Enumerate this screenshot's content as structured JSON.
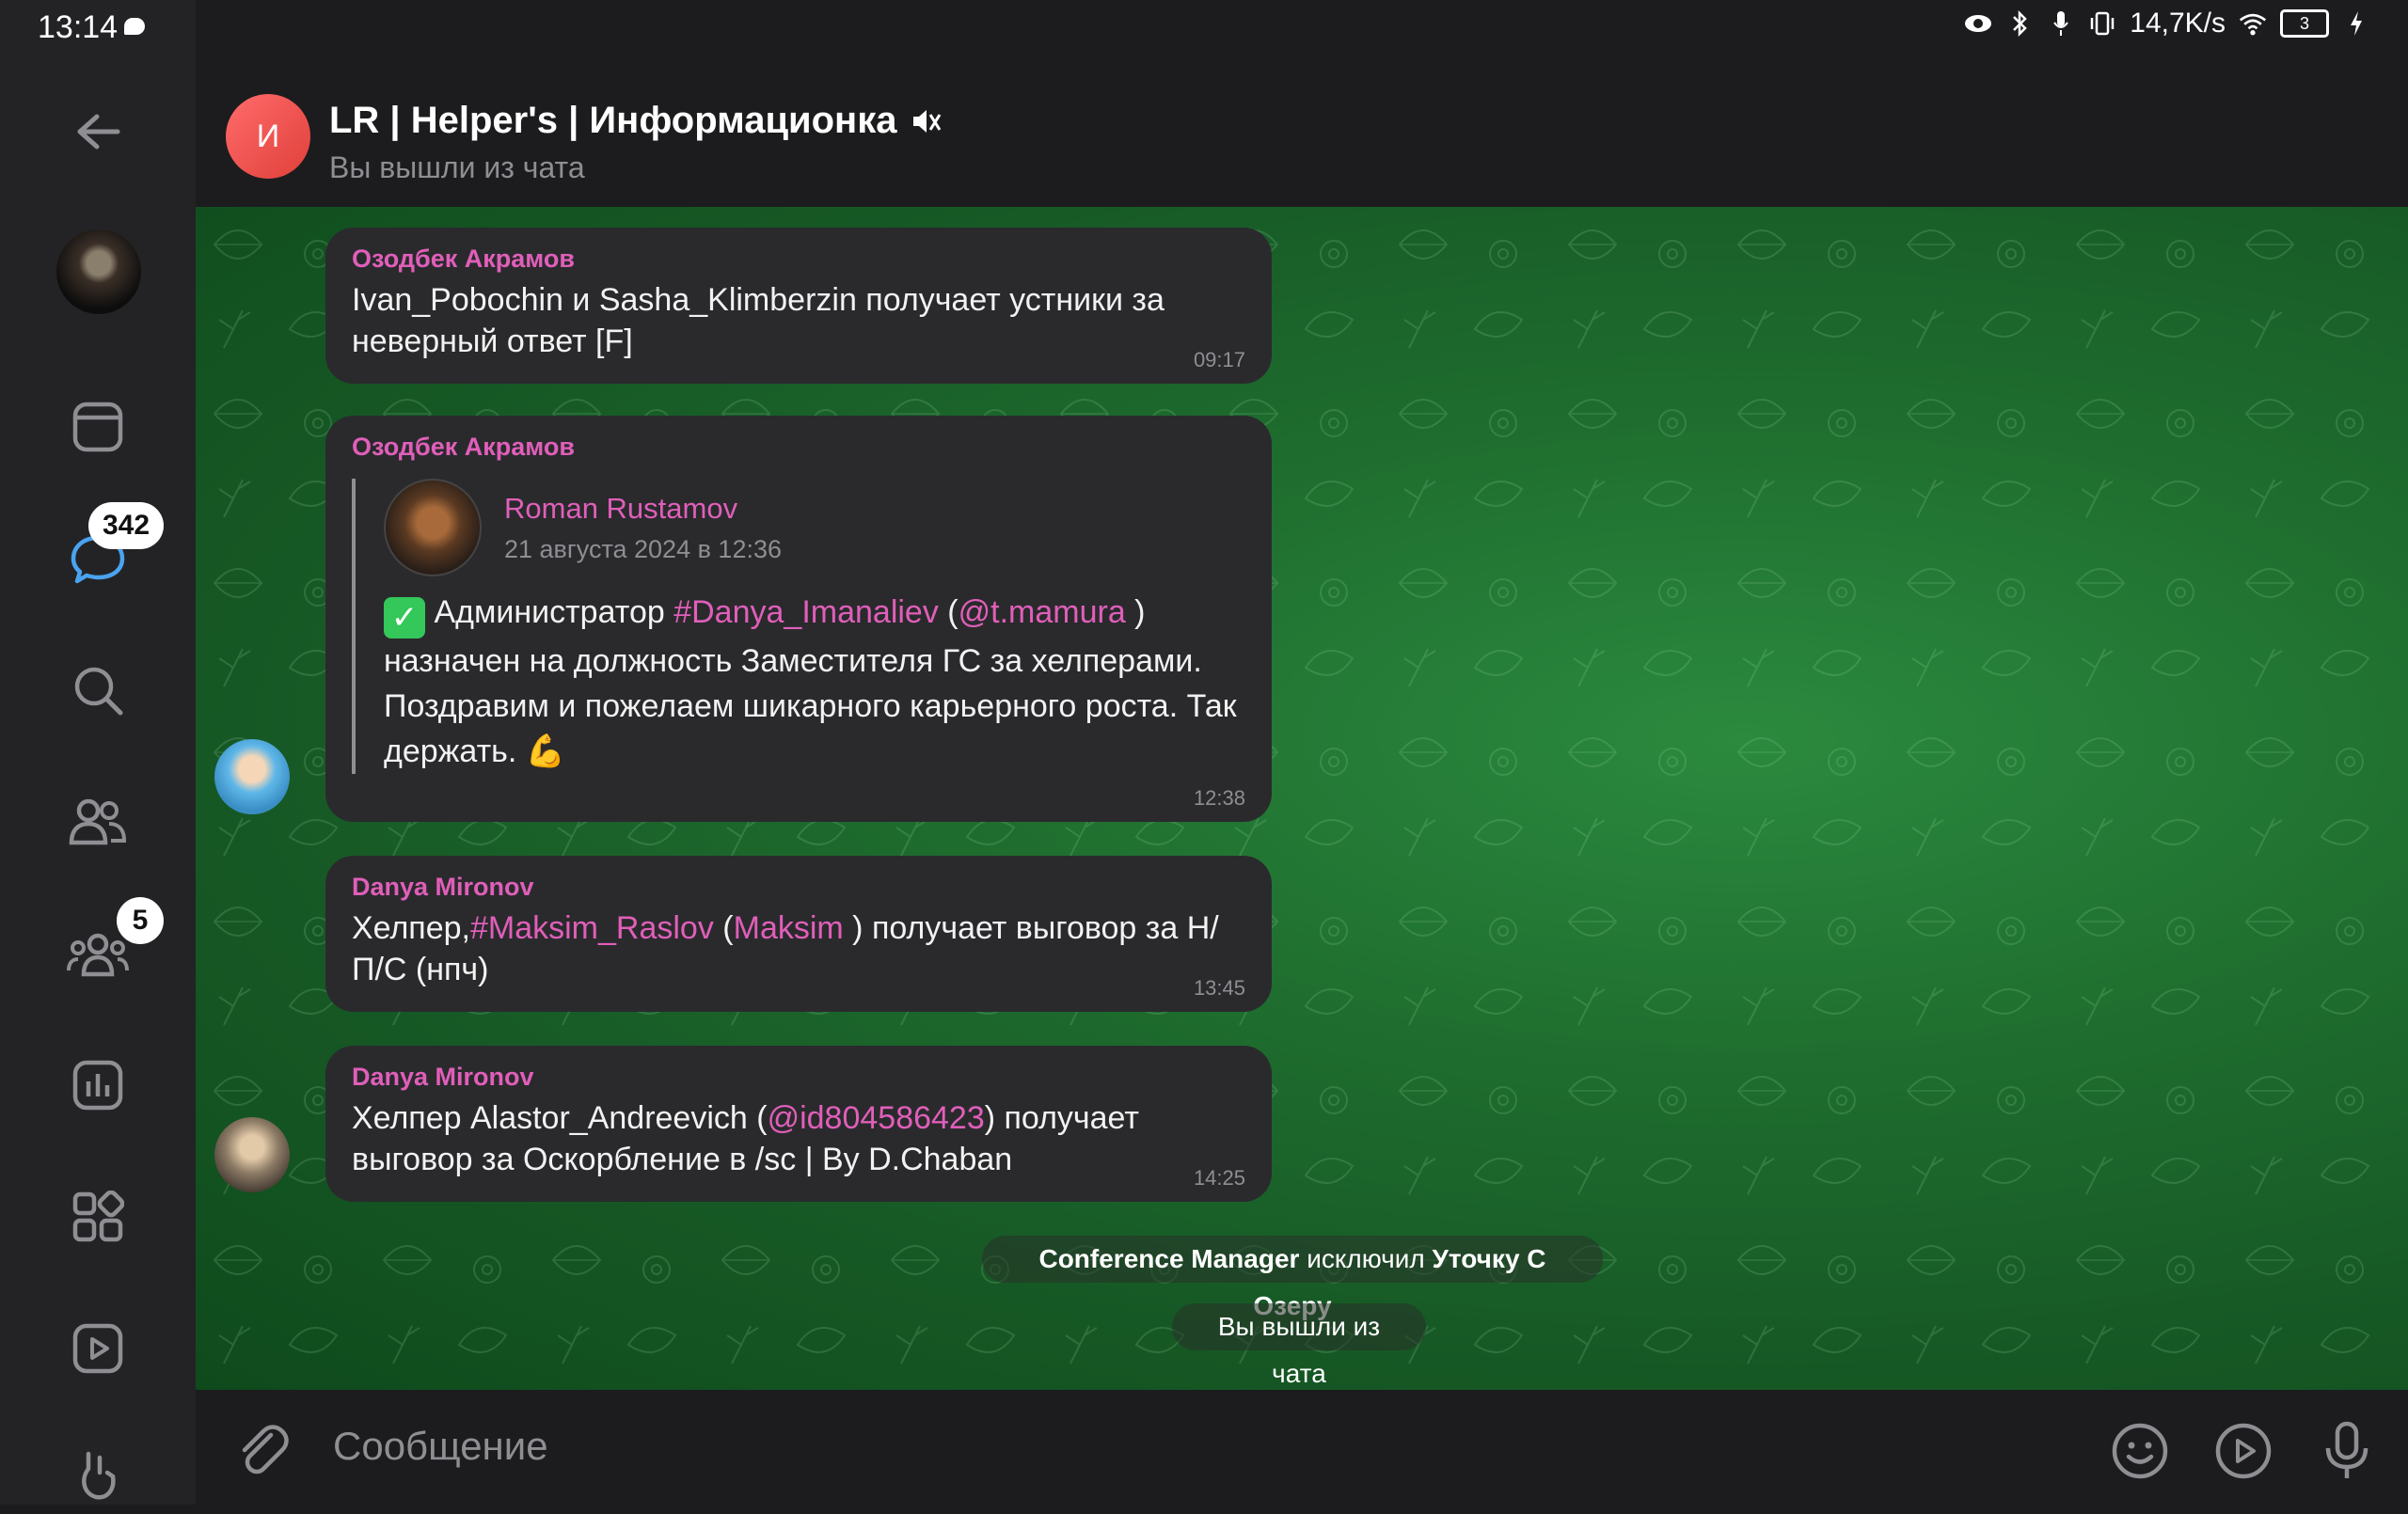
{
  "status_bar": {
    "time": "13:14",
    "network_speed": "14,7K/s",
    "battery": "3"
  },
  "rail": {
    "chats_badge": "342",
    "groups_badge": "5"
  },
  "header": {
    "avatar_letter": "И",
    "title": "LR | Helper's | Информационка",
    "subtitle": "Вы вышли из чата"
  },
  "messages": [
    {
      "sender": "Озодбек Акрамов",
      "text": "Ivan_Pobochin и Sasha_Klimberzin получает устники за неверный ответ [F]",
      "time": "09:17"
    },
    {
      "sender": "Озодбек Акрамов",
      "forward": {
        "author": "Roman Rustamov",
        "date": "21 августа 2024 в 12:36",
        "text_before": "Администратор ",
        "hashtag": "#Danya_Imanaliev",
        "paren_open": " (",
        "mention": "@t.mamura",
        "text_after": " ) назначен на должность Заместителя ГС за хелперами. Поздравим и пожелаем шикарного карьерного роста. Так держать. "
      },
      "time": "12:38"
    },
    {
      "sender": "Danya Mironov",
      "text_before": "Хелпер,",
      "hashtag": "#Maksim_Raslov",
      "paren_open": " (",
      "mention": "Maksim",
      "text_after": " ) получает выговор за Н/П/С (нпч)",
      "time": "13:45"
    },
    {
      "sender": "Danya Mironov",
      "text_before": "Хелпер Alastor_Andreevich (",
      "mention": "@id804586423",
      "text_after": ") получает выговор за Оскорбление в /sc | By D.Chaban",
      "time": "14:25"
    }
  ],
  "service": {
    "actor": "Conference Manager",
    "action": " исключил ",
    "target": "Уточку С Озеру",
    "left_chat": "Вы вышли из чата"
  },
  "input": {
    "placeholder": "Сообщение"
  },
  "colors": {
    "accent": "#e05fb9",
    "bubble": "#2a2a2d",
    "chat_bg": "#1f6e2f"
  }
}
